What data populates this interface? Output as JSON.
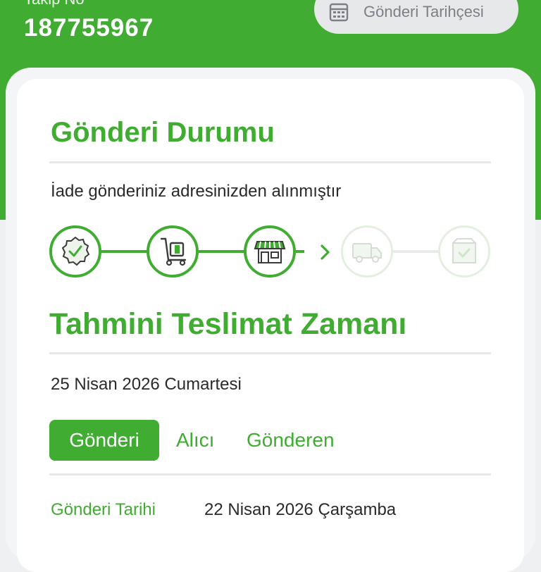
{
  "header": {
    "tracking_label": "Takip No",
    "tracking_number": "187755967",
    "history_button": {
      "label": "Gönderi Tarihçesi",
      "icon": "calendar-icon"
    }
  },
  "status": {
    "title": "Gönderi Durumu",
    "message": "İade gönderiniz adresinizden alınmıştır",
    "steps": [
      {
        "icon": "check-badge-icon",
        "state": "done"
      },
      {
        "icon": "hand-truck-icon",
        "state": "done"
      },
      {
        "icon": "store-icon",
        "state": "done"
      },
      {
        "icon": "delivery-truck-icon",
        "state": "pending"
      },
      {
        "icon": "package-check-icon",
        "state": "pending"
      }
    ]
  },
  "eta": {
    "title": "Tahmini Teslimat Zamanı",
    "date": "25 Nisan 2026 Cumartesi"
  },
  "tabs": [
    {
      "label": "Gönderi",
      "selected": true
    },
    {
      "label": "Alıcı",
      "selected": false
    },
    {
      "label": "Gönderen",
      "selected": false
    }
  ],
  "details": [
    {
      "label": "Gönderi Tarihi",
      "value": "22 Nisan 2026 Çarşamba"
    }
  ],
  "colors": {
    "accent": "#40ac32",
    "inactive": "#e4efe2"
  }
}
